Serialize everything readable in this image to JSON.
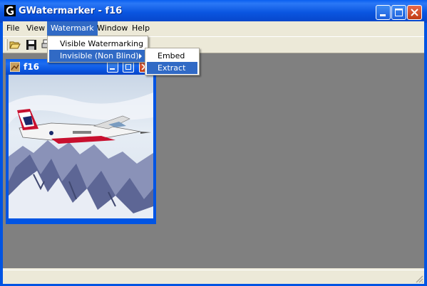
{
  "app": {
    "title": "GWatermarker - f16",
    "window_controls": [
      "minimize-icon",
      "maximize-icon",
      "close-icon"
    ]
  },
  "menubar": {
    "items": [
      {
        "label": "File"
      },
      {
        "label": "View"
      },
      {
        "label": "Watermark"
      },
      {
        "label": "Window"
      },
      {
        "label": "Help"
      }
    ],
    "active": "Watermark"
  },
  "toolbar": {
    "icons": [
      "open-folder-icon",
      "save-icon",
      "print-icon"
    ]
  },
  "watermark_menu": {
    "items": [
      {
        "label": "Visible Watermarking"
      },
      {
        "label": "Invisible (Non Blind)",
        "has_submenu": true
      }
    ]
  },
  "invisible_submenu": {
    "items": [
      {
        "label": "Embed"
      },
      {
        "label": "Extract"
      }
    ],
    "highlighted": "Extract"
  },
  "child_window": {
    "title": "f16",
    "image": "f16-fighter-jet-over-snowy-mountains"
  },
  "colors": {
    "titlebar": "#0054e3",
    "menu_highlight": "#316ac5",
    "menu_background": "#ece9d8",
    "mdi_background": "#808080",
    "close_button": "#d24a22"
  }
}
